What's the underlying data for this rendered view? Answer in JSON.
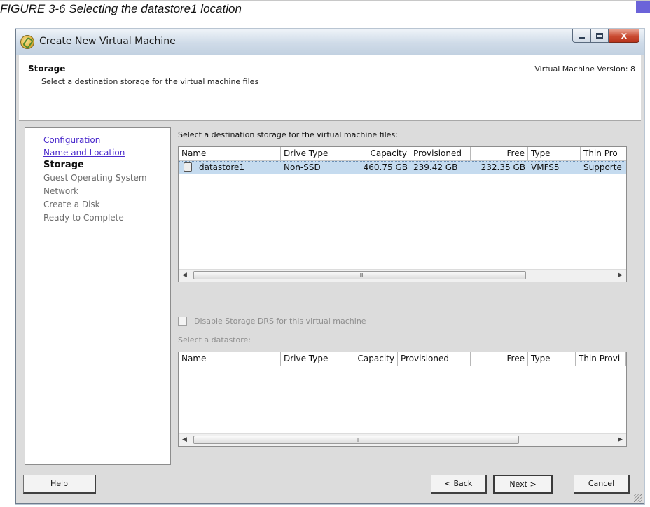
{
  "caption": {
    "text": "FIGURE 3-6 Selecting the datastore1 location",
    "accent_color": "#6b63d9"
  },
  "window": {
    "title": "Create New Virtual Machine",
    "close_glyph": "x"
  },
  "header": {
    "title": "Storage",
    "subtitle": "Select a destination storage for the virtual machine files",
    "version": "Virtual Machine Version: 8"
  },
  "nav": {
    "items": [
      {
        "label": "Configuration",
        "state": "link"
      },
      {
        "label": "Name and Location",
        "state": "link"
      },
      {
        "label": "Storage",
        "state": "current"
      },
      {
        "label": "Guest Operating System",
        "state": "disabled"
      },
      {
        "label": "Network",
        "state": "disabled"
      },
      {
        "label": "Create a Disk",
        "state": "disabled"
      },
      {
        "label": "Ready to Complete",
        "state": "disabled"
      }
    ]
  },
  "storage": {
    "label": "Select a destination storage for the virtual machine files:",
    "columns": [
      "Name",
      "Drive Type",
      "Capacity",
      "Provisioned",
      "Free",
      "Type",
      "Thin Pro"
    ],
    "rows": [
      {
        "name": "datastore1",
        "drive_type": "Non-SSD",
        "capacity": "460.75 GB",
        "provisioned": "239.42 GB",
        "free": "232.35 GB",
        "type": "VMFS5",
        "thin": "Supporte",
        "icon": "datastore-icon",
        "selected": true
      }
    ],
    "scroll_grip": "III"
  },
  "drs": {
    "label": "Disable Storage DRS for this virtual machine",
    "checked": false
  },
  "datastore": {
    "label": "Select a datastore:",
    "columns": [
      "Name",
      "Drive Type",
      "Capacity",
      "Provisioned",
      "Free",
      "Type",
      "Thin Provi"
    ],
    "scroll_grip": "III"
  },
  "buttons": {
    "help": "Help",
    "back": "< Back",
    "next": "Next >",
    "cancel": "Cancel"
  },
  "colors": {
    "selection": "#c5dbef",
    "link": "#4b2bcc",
    "close_button": "#c94a31"
  }
}
